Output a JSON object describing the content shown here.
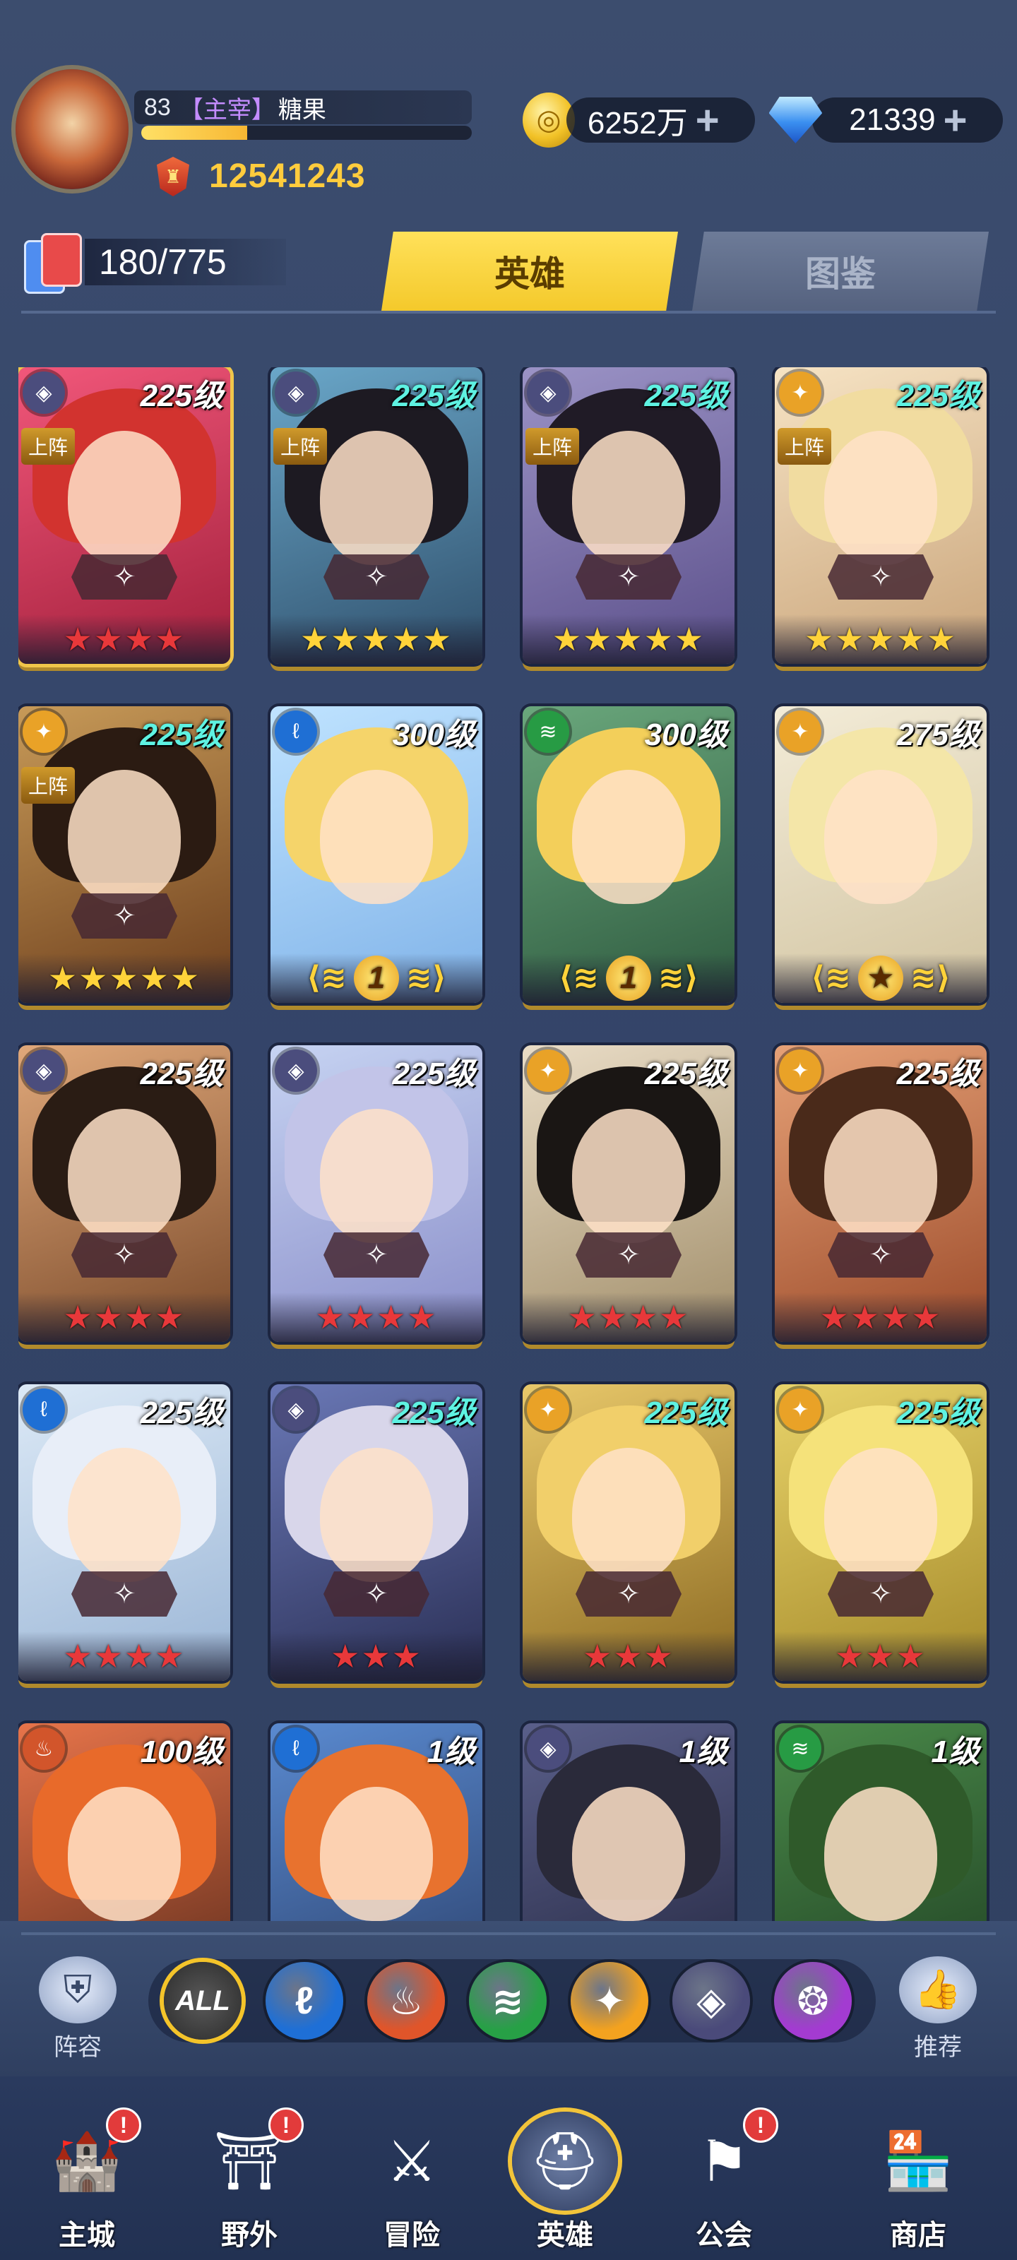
{
  "player": {
    "level": "83",
    "role": "【主宰】",
    "name": "糖果",
    "exp_fraction": 0.32,
    "power": "12541243"
  },
  "currency": {
    "gold": "6252万",
    "gems": "21339",
    "plus": "+"
  },
  "collection": {
    "count": "180/775"
  },
  "tabs": [
    {
      "label": "英雄",
      "active": true
    },
    {
      "label": "图鉴",
      "active": false
    }
  ],
  "heroes": [
    {
      "level": "225级",
      "level_color": "white",
      "element": "dark",
      "deployed": true,
      "stars": 4,
      "star_color": "red",
      "colors": [
        "#f1577a",
        "#a21f3b"
      ],
      "hair": "#d2332f"
    },
    {
      "level": "225级",
      "level_color": "cyan",
      "element": "dark",
      "deployed": true,
      "stars": 5,
      "star_color": "gold",
      "colors": [
        "#6aa7c9",
        "#2f4f6b"
      ],
      "hair": "#1d1a22"
    },
    {
      "level": "225级",
      "level_color": "cyan",
      "element": "dark",
      "deployed": true,
      "stars": 5,
      "star_color": "gold",
      "colors": [
        "#9b93c6",
        "#5b4f8a"
      ],
      "hair": "#201b26"
    },
    {
      "level": "225级",
      "level_color": "cyan",
      "element": "light",
      "deployed": true,
      "stars": 5,
      "star_color": "gold",
      "colors": [
        "#f6e3c4",
        "#c9a47a"
      ],
      "hair": "#f1dca0"
    },
    {
      "level": "225级",
      "level_color": "cyan",
      "element": "light",
      "deployed": true,
      "stars": 5,
      "star_color": "gold",
      "colors": [
        "#c79a58",
        "#6d3e1c"
      ],
      "hair": "#2b1b12"
    },
    {
      "level": "300级",
      "level_color": "white",
      "element": "water",
      "deployed": false,
      "stars": 0,
      "awaken": "1",
      "colors": [
        "#bfe3ff",
        "#7fb2e8"
      ],
      "hair": "#f5d46a"
    },
    {
      "level": "300级",
      "level_color": "white",
      "element": "wind",
      "deployed": false,
      "stars": 0,
      "awaken": "1",
      "colors": [
        "#6aa77c",
        "#2e5a3f"
      ],
      "hair": "#f3cf5a"
    },
    {
      "level": "275级",
      "level_color": "white",
      "element": "light",
      "deployed": false,
      "stars": 0,
      "awaken": "★",
      "colors": [
        "#f3ecd8",
        "#d1c3a0"
      ],
      "hair": "#f4e6a8"
    },
    {
      "level": "225级",
      "level_color": "white",
      "element": "dark",
      "deployed": false,
      "stars": 4,
      "star_color": "red",
      "colors": [
        "#e0a87a",
        "#7a4a2a"
      ],
      "hair": "#2a1c14"
    },
    {
      "level": "225级",
      "level_color": "white",
      "element": "dark",
      "deployed": false,
      "stars": 4,
      "star_color": "red",
      "colors": [
        "#c6d3f2",
        "#8a8ec9"
      ],
      "hair": "#c2c4e8"
    },
    {
      "level": "225级",
      "level_color": "white",
      "element": "light",
      "deployed": false,
      "stars": 4,
      "star_color": "red",
      "colors": [
        "#e9dcc6",
        "#a18e6a"
      ],
      "hair": "#1a1614"
    },
    {
      "level": "225级",
      "level_color": "white",
      "element": "light",
      "deployed": false,
      "stars": 4,
      "star_color": "red",
      "colors": [
        "#e6a177",
        "#9c4b2a"
      ],
      "hair": "#4a2a1a"
    },
    {
      "level": "225级",
      "level_color": "white",
      "element": "water",
      "deployed": false,
      "stars": 4,
      "star_color": "red",
      "colors": [
        "#dce9f6",
        "#9bb6d6"
      ],
      "hair": "#e8eef8"
    },
    {
      "level": "225级",
      "level_color": "cyan",
      "element": "dark",
      "deployed": false,
      "stars": 3,
      "star_color": "red",
      "colors": [
        "#6a78b6",
        "#2a2f55"
      ],
      "hair": "#d8d6ea"
    },
    {
      "level": "225级",
      "level_color": "cyan",
      "element": "light",
      "deployed": false,
      "stars": 3,
      "star_color": "red",
      "colors": [
        "#e8c86a",
        "#8c6a22"
      ],
      "hair": "#f1cf6a"
    },
    {
      "level": "225级",
      "level_color": "cyan",
      "element": "light",
      "deployed": false,
      "stars": 3,
      "star_color": "red",
      "colors": [
        "#e8d36a",
        "#a58a2a"
      ],
      "hair": "#f5e27a"
    },
    {
      "level": "100级",
      "level_color": "white",
      "element": "fire",
      "deployed": false,
      "stars": 0,
      "colors": [
        "#e7744a",
        "#5a2a1a"
      ],
      "hair": "#e86a2a"
    },
    {
      "level": "1级",
      "level_color": "white",
      "element": "water",
      "deployed": false,
      "stars": 0,
      "colors": [
        "#5a8ad0",
        "#2a3f6a"
      ],
      "hair": "#e8722e"
    },
    {
      "level": "1级",
      "level_color": "white",
      "element": "dark",
      "deployed": false,
      "stars": 0,
      "colors": [
        "#5a5f8a",
        "#23263f"
      ],
      "hair": "#2a2a3a"
    },
    {
      "level": "1级",
      "level_color": "white",
      "element": "wind",
      "deployed": false,
      "stars": 0,
      "colors": [
        "#4a8a4a",
        "#1f3f22"
      ],
      "hair": "#2f5a2a"
    }
  ],
  "hero_labels": {
    "deploy": "上阵"
  },
  "filter": {
    "left_label": "阵容",
    "right_label": "推荐",
    "all_label": "ALL",
    "chips": [
      {
        "name": "water",
        "color": "#1e6fd6",
        "glyph": "ℓ"
      },
      {
        "name": "fire",
        "color": "#e0552a",
        "glyph": "♨"
      },
      {
        "name": "wind",
        "color": "#27a046",
        "glyph": "≋"
      },
      {
        "name": "light",
        "color": "#f3a21f",
        "glyph": "✦"
      },
      {
        "name": "dark",
        "color": "#4a4a7a",
        "glyph": "◈"
      },
      {
        "name": "void",
        "color": "#a33bd1",
        "glyph": "❂"
      }
    ]
  },
  "nav": [
    {
      "label": "主城",
      "badge": "!",
      "icon": "castle-icon",
      "glyph": "🏰"
    },
    {
      "label": "野外",
      "badge": "!",
      "icon": "portal-icon",
      "glyph": "⛩"
    },
    {
      "label": "冒险",
      "badge": "",
      "icon": "sword-icon",
      "glyph": "⚔"
    },
    {
      "label": "英雄",
      "badge": "",
      "icon": "helmet-icon",
      "glyph": "⛑",
      "active": true
    },
    {
      "label": "公会",
      "badge": "!",
      "icon": "banner-icon",
      "glyph": "⚑"
    },
    {
      "label": "商店",
      "badge": "",
      "icon": "shop-icon",
      "glyph": "🏪"
    }
  ],
  "element_colors": {
    "dark": "#4b4d7d",
    "light": "#e9a227",
    "water": "#1f6fd4",
    "wind": "#279b44",
    "fire": "#d2552b"
  },
  "element_glyphs": {
    "dark": "◈",
    "light": "✦",
    "water": "ℓ",
    "wind": "≋",
    "fire": "♨"
  }
}
